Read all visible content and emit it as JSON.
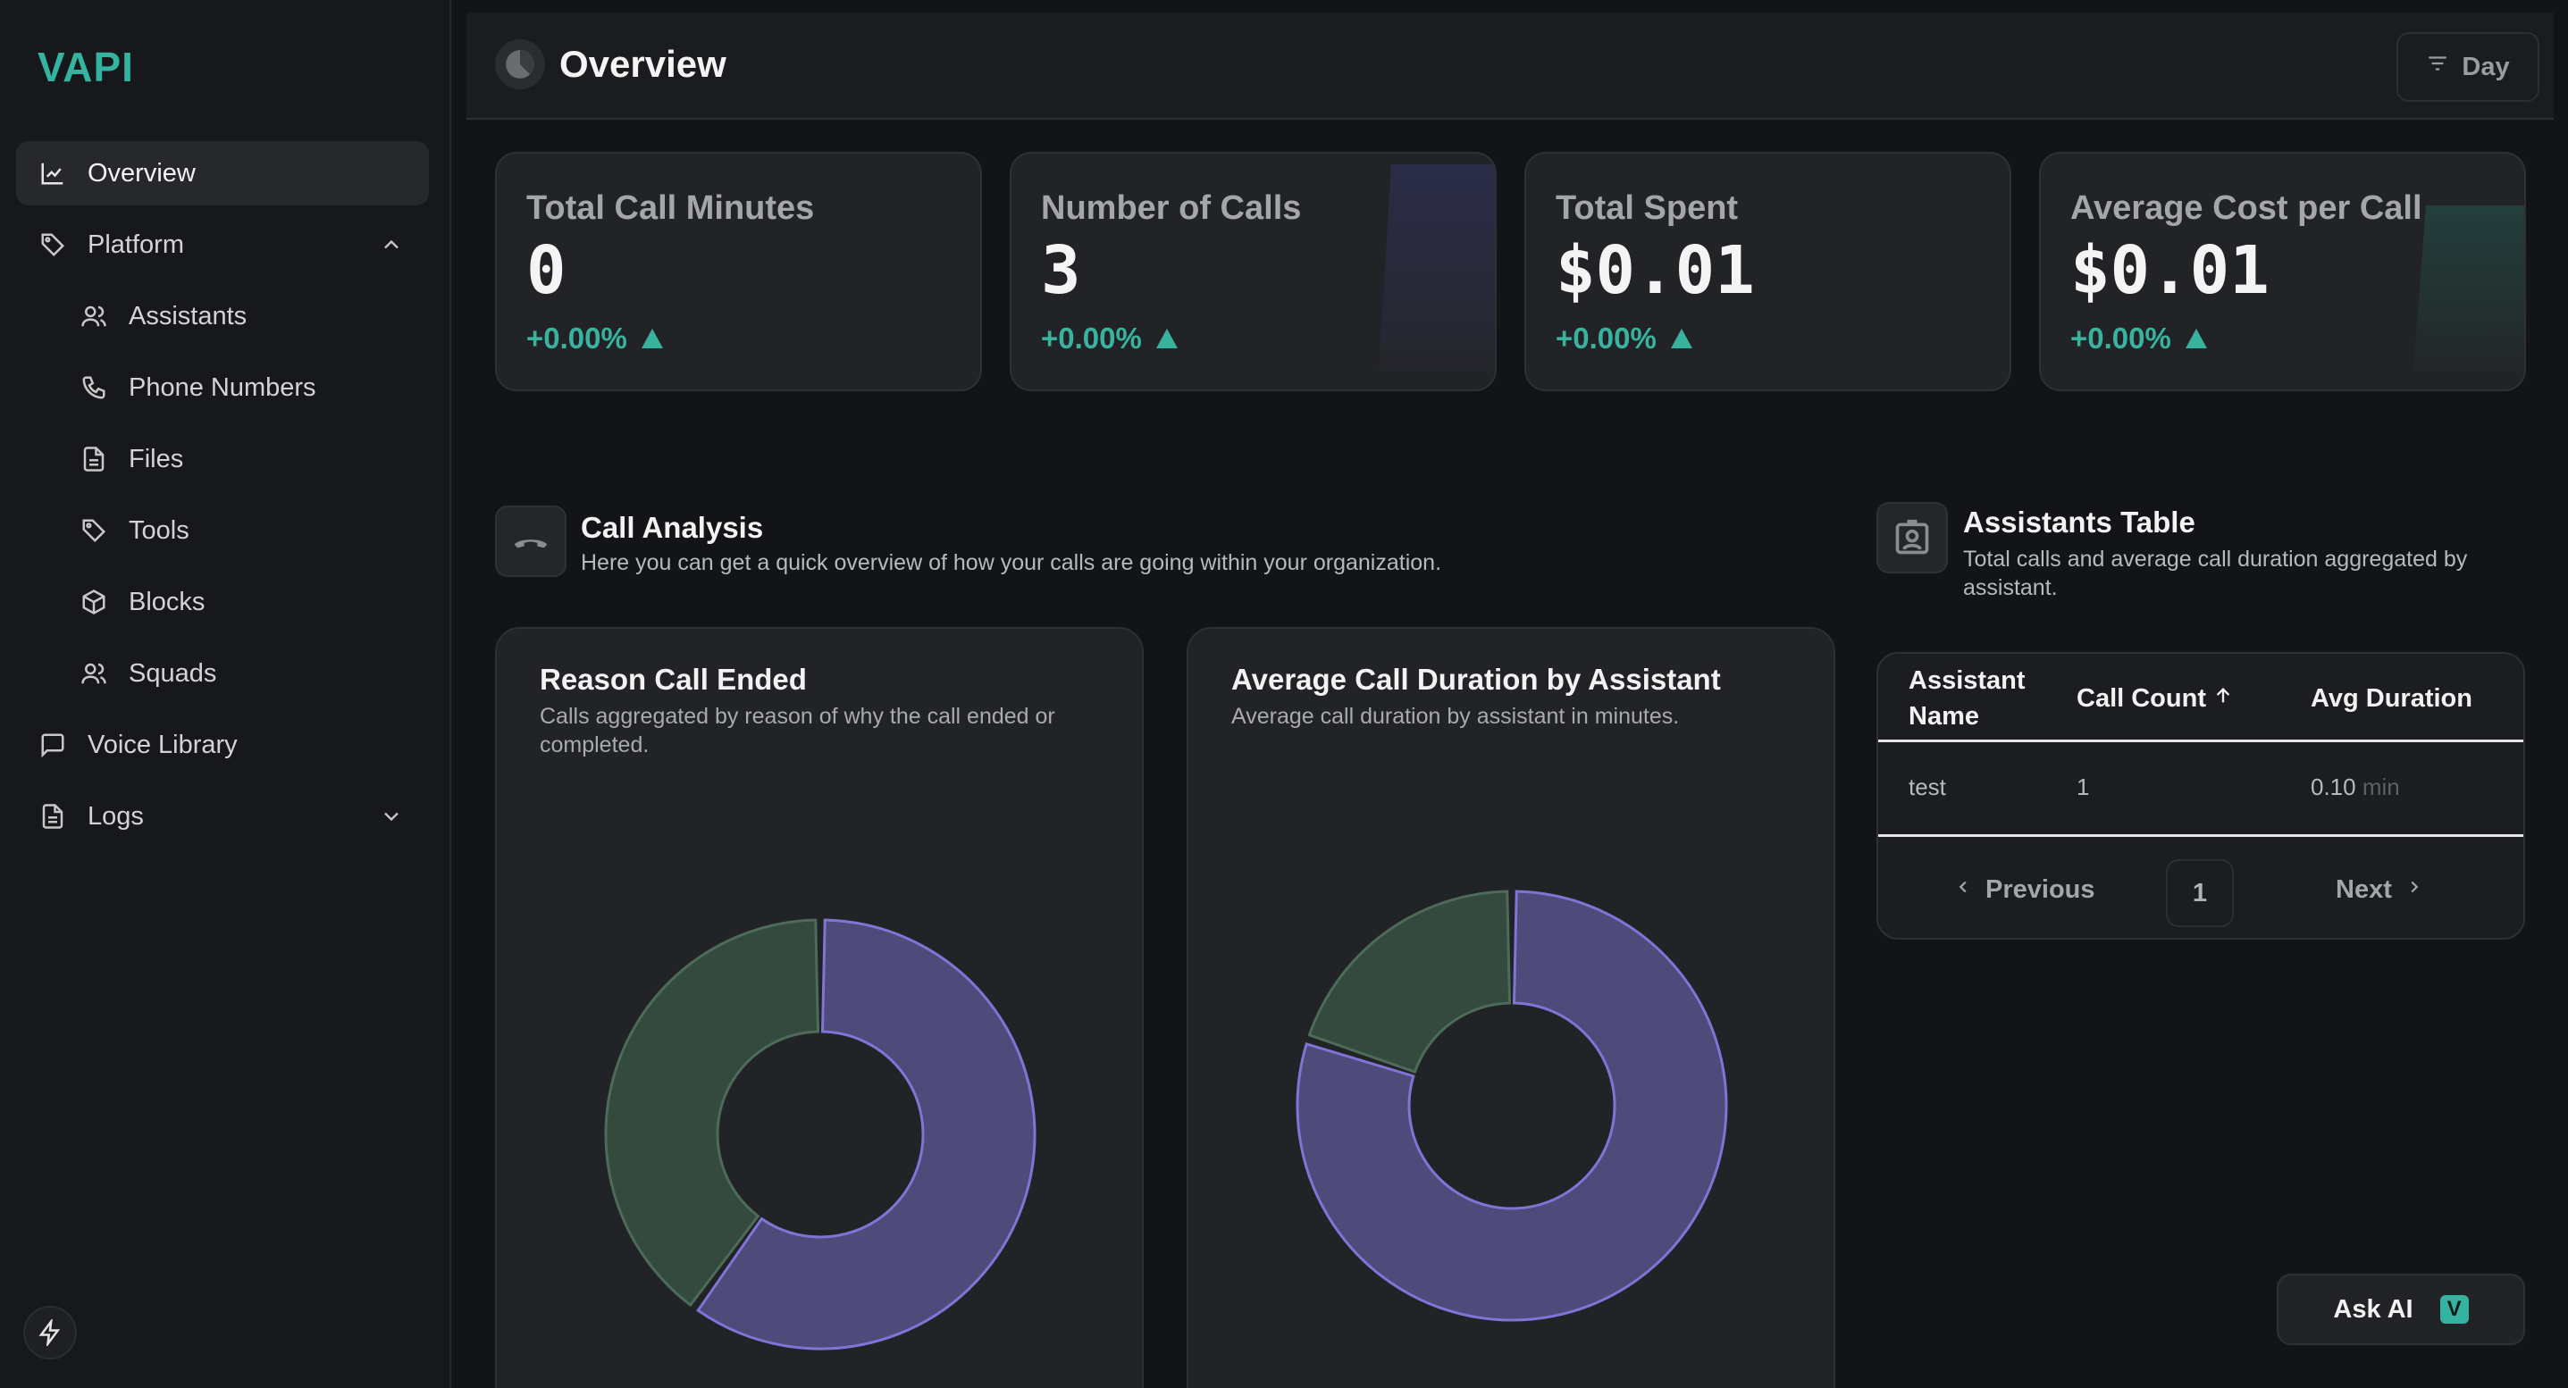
{
  "app": {
    "logo": "VAPI"
  },
  "sidebar": {
    "items": [
      {
        "label": "Overview",
        "icon": "chart-line-icon"
      },
      {
        "label": "Platform",
        "icon": "tag-icon"
      },
      {
        "label": "Assistants",
        "icon": "users-icon"
      },
      {
        "label": "Phone Numbers",
        "icon": "phone-icon"
      },
      {
        "label": "Files",
        "icon": "file-icon"
      },
      {
        "label": "Tools",
        "icon": "tag-icon"
      },
      {
        "label": "Blocks",
        "icon": "cube-icon"
      },
      {
        "label": "Squads",
        "icon": "users-icon"
      },
      {
        "label": "Voice Library",
        "icon": "message-square-icon"
      },
      {
        "label": "Logs",
        "icon": "file-text-icon"
      }
    ]
  },
  "header": {
    "title": "Overview",
    "filter_label": "Day"
  },
  "stats": [
    {
      "label": "Total Call Minutes",
      "value": "0",
      "delta": "+0.00%"
    },
    {
      "label": "Number of Calls",
      "value": "3",
      "delta": "+0.00%"
    },
    {
      "label": "Total Spent",
      "value": "$0.01",
      "delta": "+0.00%"
    },
    {
      "label": "Average Cost per Call",
      "value": "$0.01",
      "delta": "+0.00%"
    }
  ],
  "call_analysis": {
    "title": "Call Analysis",
    "subtitle": "Here you can get a quick overview of how your calls are going within your organization."
  },
  "assistants_table": {
    "title": "Assistants Table",
    "subtitle": "Total calls and average call duration aggregated by assistant.",
    "columns": [
      "Assistant Name",
      "Call Count",
      "Avg Duration"
    ],
    "rows": [
      {
        "name": "test",
        "count": "1",
        "duration": "0.10",
        "unit": "min"
      }
    ],
    "pager": {
      "previous": "Previous",
      "page": "1",
      "next": "Next"
    }
  },
  "ask_ai": {
    "label": "Ask AI",
    "badge": "V"
  },
  "colors": {
    "accent": "#34b3a0",
    "purple": "#4e4a7a",
    "green": "#344a3f"
  },
  "chart_data": [
    {
      "type": "pie",
      "title": "Reason Call Ended",
      "subtitle": "Calls aggregated by reason of why the call ended or completed.",
      "values": [
        60,
        40
      ]
    },
    {
      "type": "pie",
      "title": "Average Call Duration by Assistant",
      "subtitle": "Average call duration by assistant in minutes.",
      "values": [
        80,
        20
      ]
    }
  ]
}
